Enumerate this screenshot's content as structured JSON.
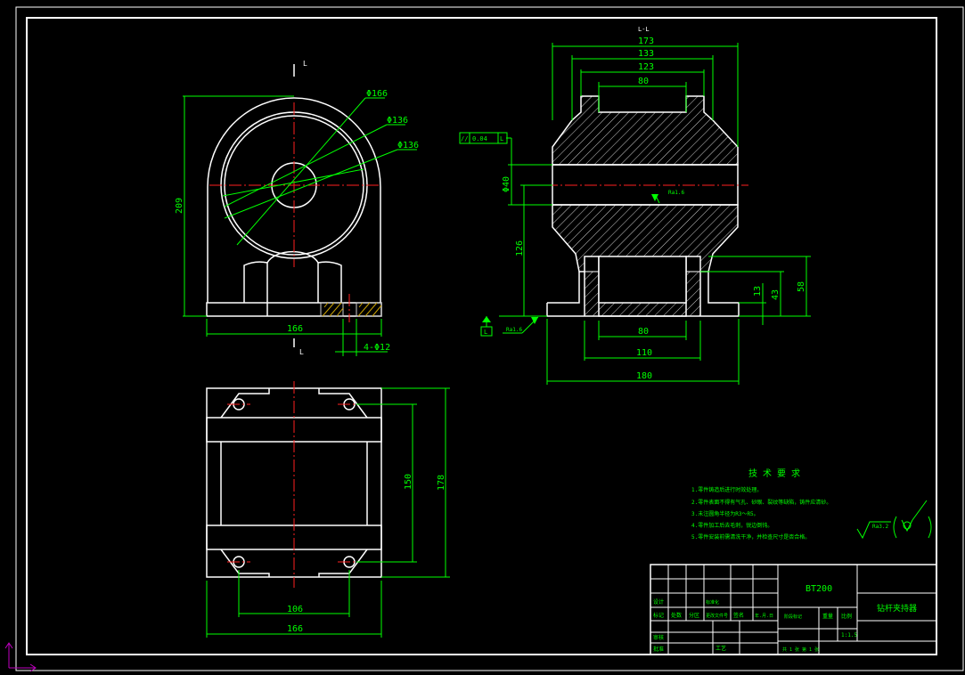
{
  "colors": {
    "background": "#000000",
    "outline": "#ffffff",
    "dimension": "#00ff00",
    "centerline": "#ff2020",
    "note": "#00ff00",
    "ucs": "#c000c0"
  },
  "front_view": {
    "section_mark_top": "L",
    "section_mark_bottom": "L",
    "dims": {
      "d1": "Φ166",
      "d2": "Φ136",
      "d3": "Φ136",
      "height": "209",
      "width": "166",
      "holes": "4-Φ12"
    }
  },
  "section_view": {
    "title": "L-L",
    "dims": {
      "w173": "173",
      "w133": "133",
      "w123": "123",
      "w80_top": "80",
      "bore": "Φ40",
      "h126": "126",
      "w80_bottom": "80",
      "w110": "110",
      "w180": "180",
      "h13": "13",
      "h43": "43",
      "h58": "58"
    },
    "tolerance_frame": [
      "//",
      "0.04",
      "L"
    ],
    "datum": "L",
    "roughness_bore": "Ra1.6",
    "roughness_base": "Ra1.6"
  },
  "top_view": {
    "dims": {
      "h150": "150",
      "h178": "178",
      "w106": "106",
      "w166": "166"
    }
  },
  "tech_requirements": {
    "title": "技 术 要 求",
    "items": [
      "1.零件铸造后进行时效处理。",
      "2.零件表面不得有气孔、砂眼、裂纹等缺陷，铸件应清砂。",
      "3.未注圆角半径为R3～R5。",
      "4.零件加工后去毛刺，锐边倒钝。",
      "5.零件安装前需清洗干净，并检查尺寸是否合格。"
    ],
    "roughness_other": "Ra3.2"
  },
  "title_block": {
    "drawing_code": "BT200",
    "part_name": "钻杆夹持器",
    "scale": "1:1.5",
    "row_labels": [
      "标记",
      "处数",
      "分区",
      "更改文件号",
      "签名",
      "年.月.日"
    ],
    "role_labels": [
      "设计",
      "标准化"
    ],
    "check_labels": [
      "审核",
      "工艺"
    ],
    "approve_label": "批准",
    "stage_labels": [
      "阶段标记",
      "重量",
      "比例"
    ],
    "sheet_info": "共  1  张     第  1  张"
  }
}
